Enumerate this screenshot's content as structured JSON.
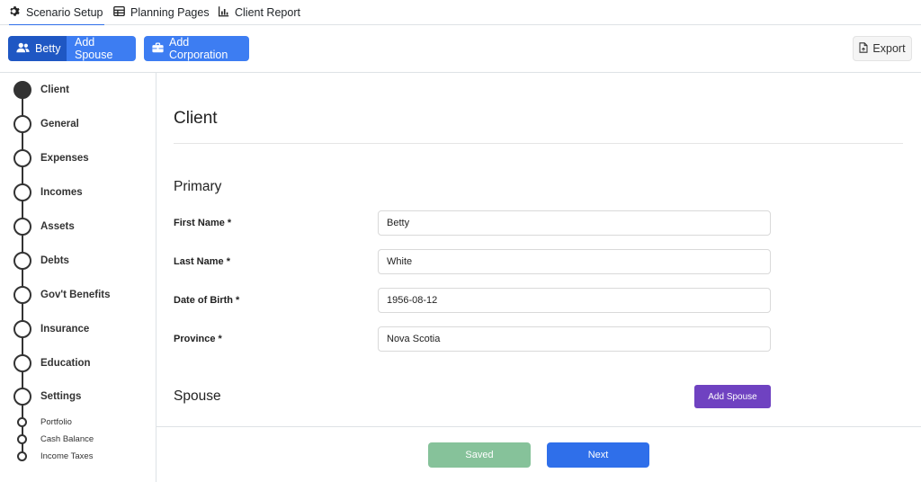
{
  "tabs": [
    {
      "label": "Scenario Setup",
      "icon": "gear-icon",
      "active": true
    },
    {
      "label": "Planning Pages",
      "icon": "table-icon",
      "active": false
    },
    {
      "label": "Client Report",
      "icon": "chart-icon",
      "active": false
    }
  ],
  "toolbar": {
    "client_label": "Betty",
    "add_spouse_label": "Add Spouse",
    "add_corporation_label": "Add Corporation",
    "export_label": "Export"
  },
  "sidebar": {
    "steps": [
      {
        "label": "Client",
        "current": true
      },
      {
        "label": "General"
      },
      {
        "label": "Expenses"
      },
      {
        "label": "Incomes"
      },
      {
        "label": "Assets"
      },
      {
        "label": "Debts"
      },
      {
        "label": "Gov't Benefits"
      },
      {
        "label": "Insurance"
      },
      {
        "label": "Education"
      },
      {
        "label": "Settings"
      }
    ],
    "substeps": [
      {
        "label": "Portfolio"
      },
      {
        "label": "Cash Balance"
      },
      {
        "label": "Income Taxes"
      }
    ]
  },
  "main": {
    "title": "Client",
    "primary_title": "Primary",
    "fields": [
      {
        "label": "First Name *",
        "value": "Betty"
      },
      {
        "label": "Last Name *",
        "value": "White"
      },
      {
        "label": "Date of Birth *",
        "value": "1956-08-12"
      },
      {
        "label": "Province *",
        "value": "Nova Scotia"
      }
    ],
    "spouse_title": "Spouse",
    "add_spouse_button": "Add Spouse"
  },
  "footer": {
    "saved_label": "Saved",
    "next_label": "Next"
  },
  "colors": {
    "primary": "#2f6fea",
    "primary_dark": "#1f57c3",
    "purple": "#6f42c1",
    "saved_green": "#86c29a"
  }
}
